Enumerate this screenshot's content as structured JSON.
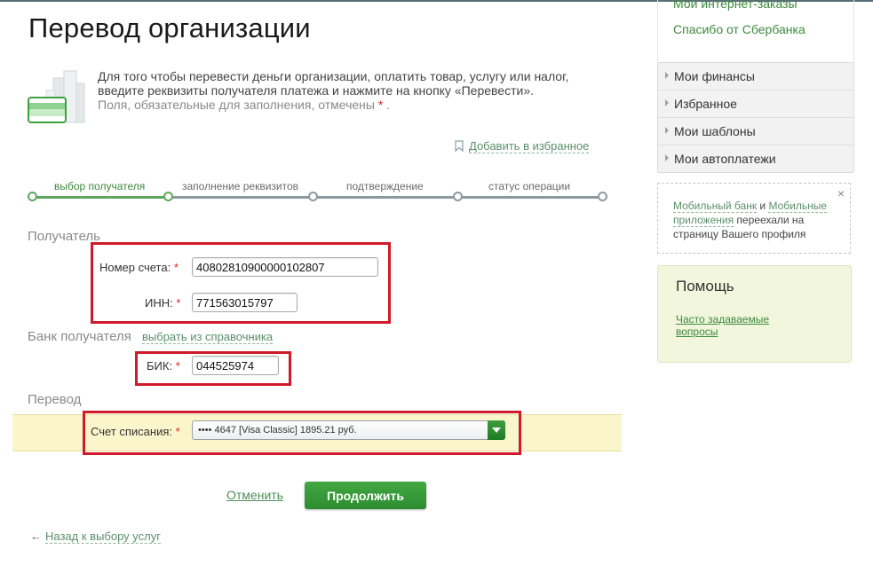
{
  "page": {
    "title": "Перевод организации",
    "intro_line1": "Для того чтобы перевести деньги организации, оплатить товар, услугу или налог,",
    "intro_line2": "введите реквизиты получателя платежа и нажмите на кнопку «Перевести».",
    "intro_line3": "Поля, обязательные для заполнения, отмечены",
    "required_mark": "*",
    "intro_line3_end": ".",
    "add_favorite": "Добавить в избранное"
  },
  "steps": [
    {
      "label": "выбор получателя",
      "state": "active"
    },
    {
      "label": "заполнение реквизитов",
      "state": "pending"
    },
    {
      "label": "подтверждение",
      "state": "pending"
    },
    {
      "label": "статус операции",
      "state": "pending"
    }
  ],
  "recipient": {
    "heading": "Получатель",
    "account_label": "Номер счета:",
    "account_value": "40802810900000102807",
    "inn_label": "ИНН:",
    "inn_value": "771563015797"
  },
  "bank": {
    "heading": "Банк получателя",
    "dictionary_link": "выбрать из справочника",
    "bik_label": "БИК:",
    "bik_value": "044525974"
  },
  "transfer": {
    "heading": "Перевод",
    "debit_label": "Счет списания:",
    "debit_value": "•••• 4647 [Visa Classic] 1895.21 руб."
  },
  "actions": {
    "cancel": "Отменить",
    "continue": "Продолжить",
    "back_arrow": "←",
    "back": "Назад к выбору услуг"
  },
  "sidebar": {
    "top_links": [
      "Мои интернет-заказы",
      "Спасибо от Сбербанка"
    ],
    "menu": [
      "Мои финансы",
      "Избранное",
      "Мои шаблоны",
      "Мои автоплатежи"
    ],
    "notice": {
      "link1": "Мобильный банк",
      "and": " и ",
      "link2": "Мобильные приложения",
      "rest": " переехали на страницу Вашего профиля",
      "close": "×"
    },
    "help": {
      "title": "Помощь",
      "faq": "Часто задаваемые вопросы"
    }
  },
  "colors": {
    "accent_green": "#2c8c2f",
    "highlight_red": "#d01a2a",
    "band_yellow": "#fbf5cc"
  },
  "icons": [
    "buildings-card-icon",
    "bookmark-icon",
    "chevron-right-icon",
    "dropdown-arrow-icon",
    "close-icon",
    "back-arrow-icon"
  ]
}
